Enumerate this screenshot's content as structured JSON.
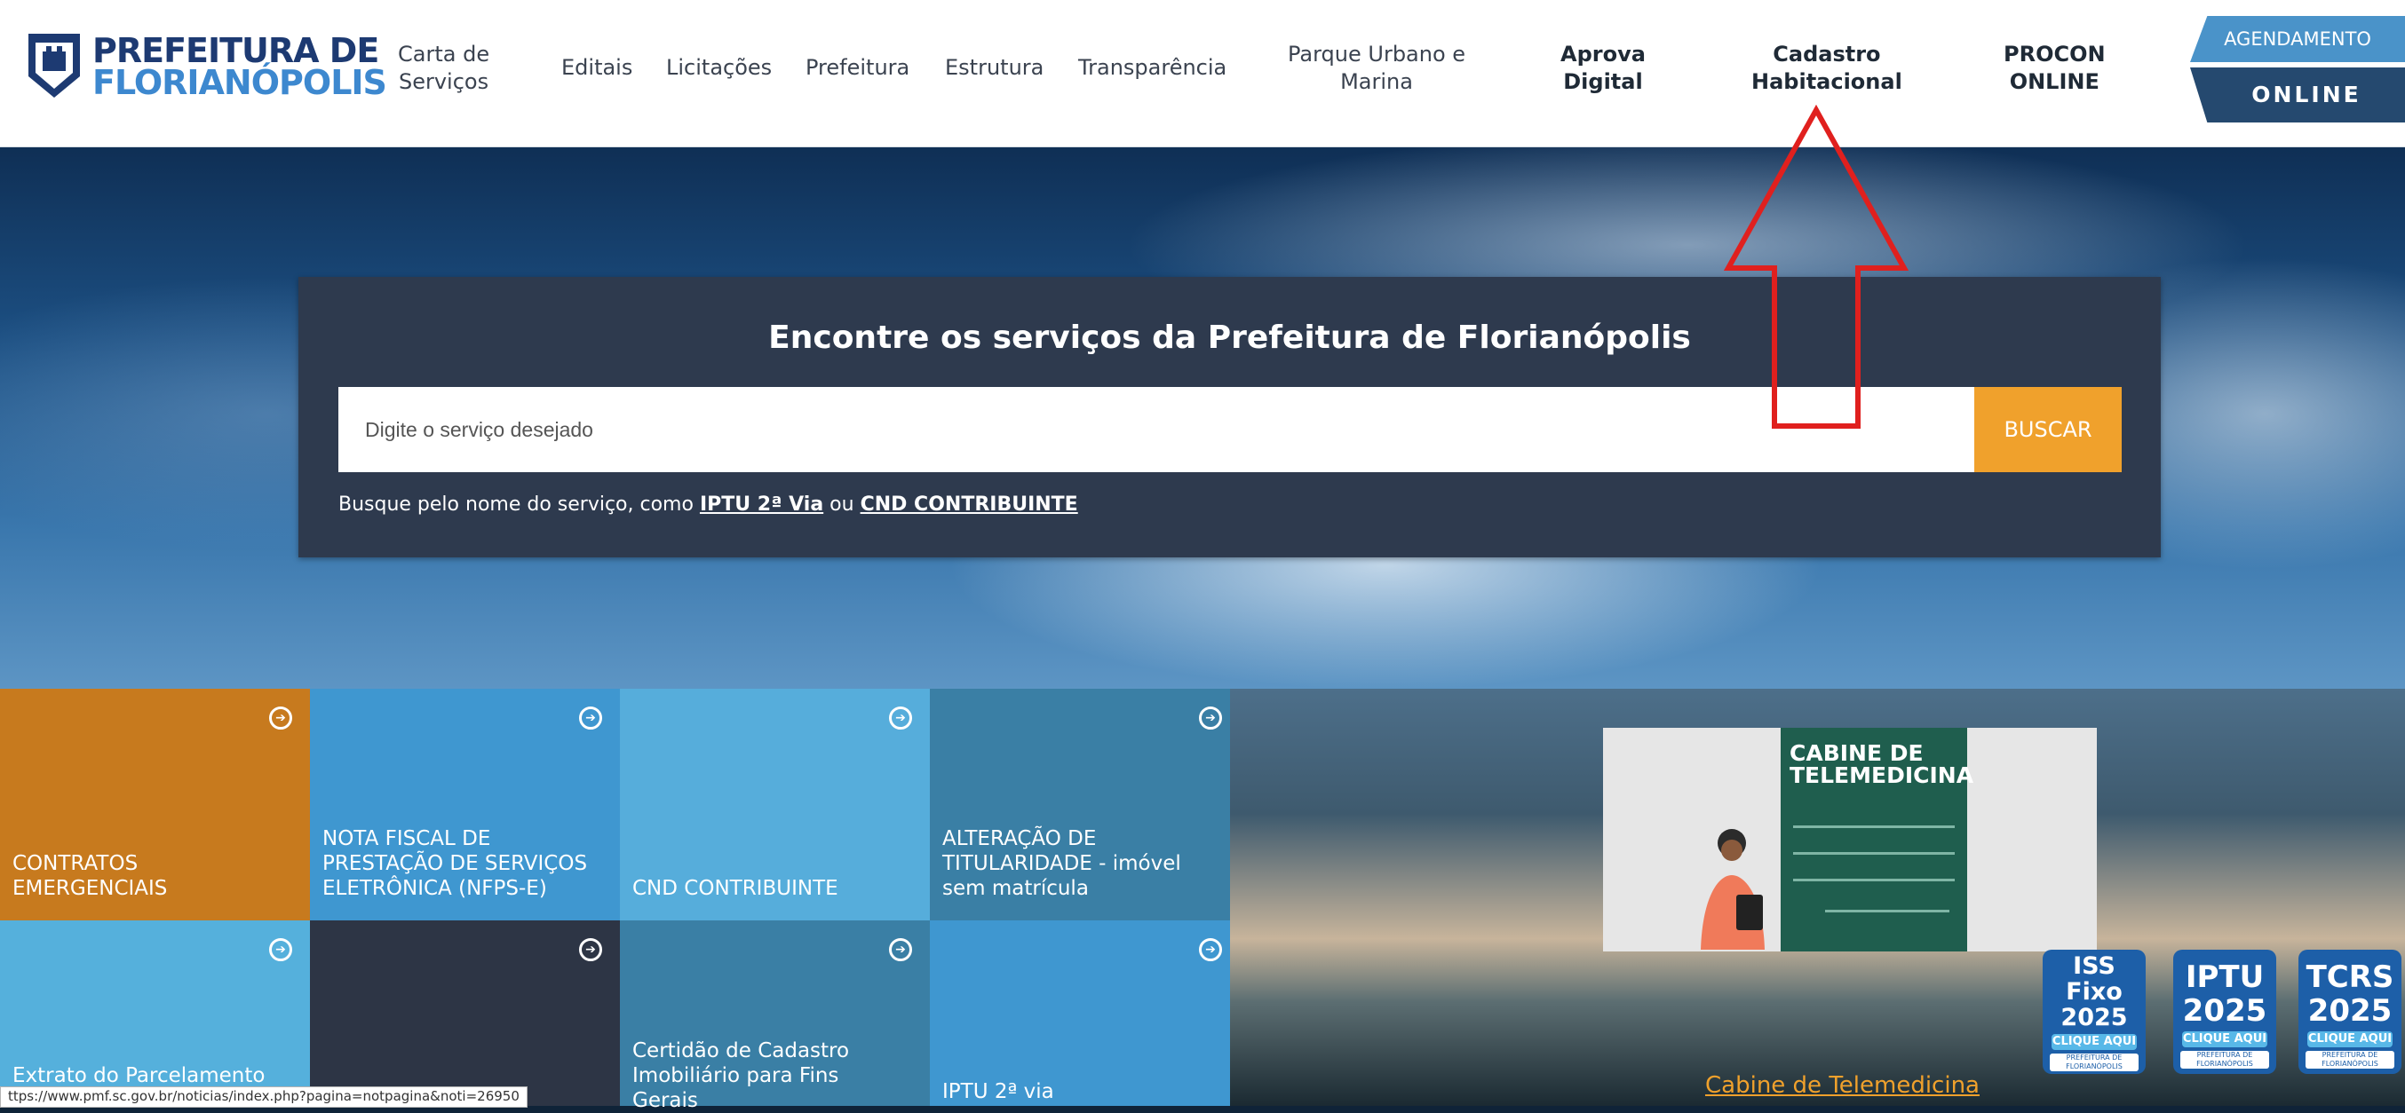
{
  "header": {
    "logo_line1": "PREFEITURA DE",
    "logo_line2": "FLORIANÓPOLIS",
    "nav": [
      {
        "line1": "Carta de",
        "line2": "Serviços"
      },
      {
        "line1": "Editais",
        "line2": ""
      },
      {
        "line1": "Licitações",
        "line2": ""
      },
      {
        "line1": "Prefeitura",
        "line2": ""
      },
      {
        "line1": "Estrutura",
        "line2": ""
      },
      {
        "line1": "Transparência",
        "line2": ""
      },
      {
        "line1": "Parque Urbano e",
        "line2": "Marina"
      },
      {
        "line1": "Aprova",
        "line2": "Digital"
      },
      {
        "line1": "Cadastro",
        "line2": "Habitacional"
      },
      {
        "line1": "PROCON",
        "line2": "ONLINE"
      }
    ],
    "agendamento_top": "AGENDAMENTO",
    "agendamento_bottom": "ONLINE"
  },
  "search": {
    "title": "Encontre os serviços da Prefeitura de Florianópolis",
    "placeholder": "Digite o serviço desejado",
    "button_label": "BUSCAR",
    "hint_prefix": "Busque pelo nome do serviço, como ",
    "hint_link1": "IPTU 2ª Via",
    "hint_middle": " ou ",
    "hint_link2": "CND CONTRIBUINTE"
  },
  "tiles": [
    {
      "label": "CONTRATOS EMERGENCIAIS",
      "color": "#c77a1e"
    },
    {
      "label": "NOTA FISCAL DE PRESTAÇÃO DE SERVIÇOS ELETRÔNICA (NFPS-E)",
      "color": "#3f97d0"
    },
    {
      "label": "CND CONTRIBUINTE",
      "color": "#56addb"
    },
    {
      "label": "ALTERAÇÃO DE TITULARIDADE - imóvel sem matrícula",
      "color": "#3a7fa5"
    },
    {
      "label": "Extrato do Parcelamento",
      "color": "#55b0dc"
    },
    {
      "label": "",
      "color": "#2d3545"
    },
    {
      "label": "Certidão de Cadastro Imobiliário para Fins Gerais",
      "color": "#3a7fa5"
    },
    {
      "label": "IPTU 2ª via",
      "color": "#3f97d0"
    }
  ],
  "promo": {
    "title": "CABINE DE TELEMEDICINA",
    "link_label": "Cabine de Telemedicina"
  },
  "badges": [
    {
      "l1": "ISS",
      "l2": "Fixo",
      "l3": "2025",
      "cta": "CLIQUE AQUI",
      "foot": "PREFEITURA DE FLORIANÓPOLIS"
    },
    {
      "l1": "IPTU",
      "l2": "2025",
      "l3": "",
      "cta": "CLIQUE AQUI",
      "foot": "PREFEITURA DE FLORIANÓPOLIS"
    },
    {
      "l1": "TCRS",
      "l2": "2025",
      "l3": "",
      "cta": "CLIQUE AQUI",
      "foot": "PREFEITURA DE FLORIANÓPOLIS"
    }
  ],
  "status_url": "ttps://www.pmf.sc.gov.br/noticias/index.php?pagina=notpagina&noti=26950",
  "colors": {
    "accent_orange": "#f0a12c",
    "navy": "#1d3a72",
    "search_bg": "#2e3a4e",
    "arrow_red": "#e0201e"
  }
}
